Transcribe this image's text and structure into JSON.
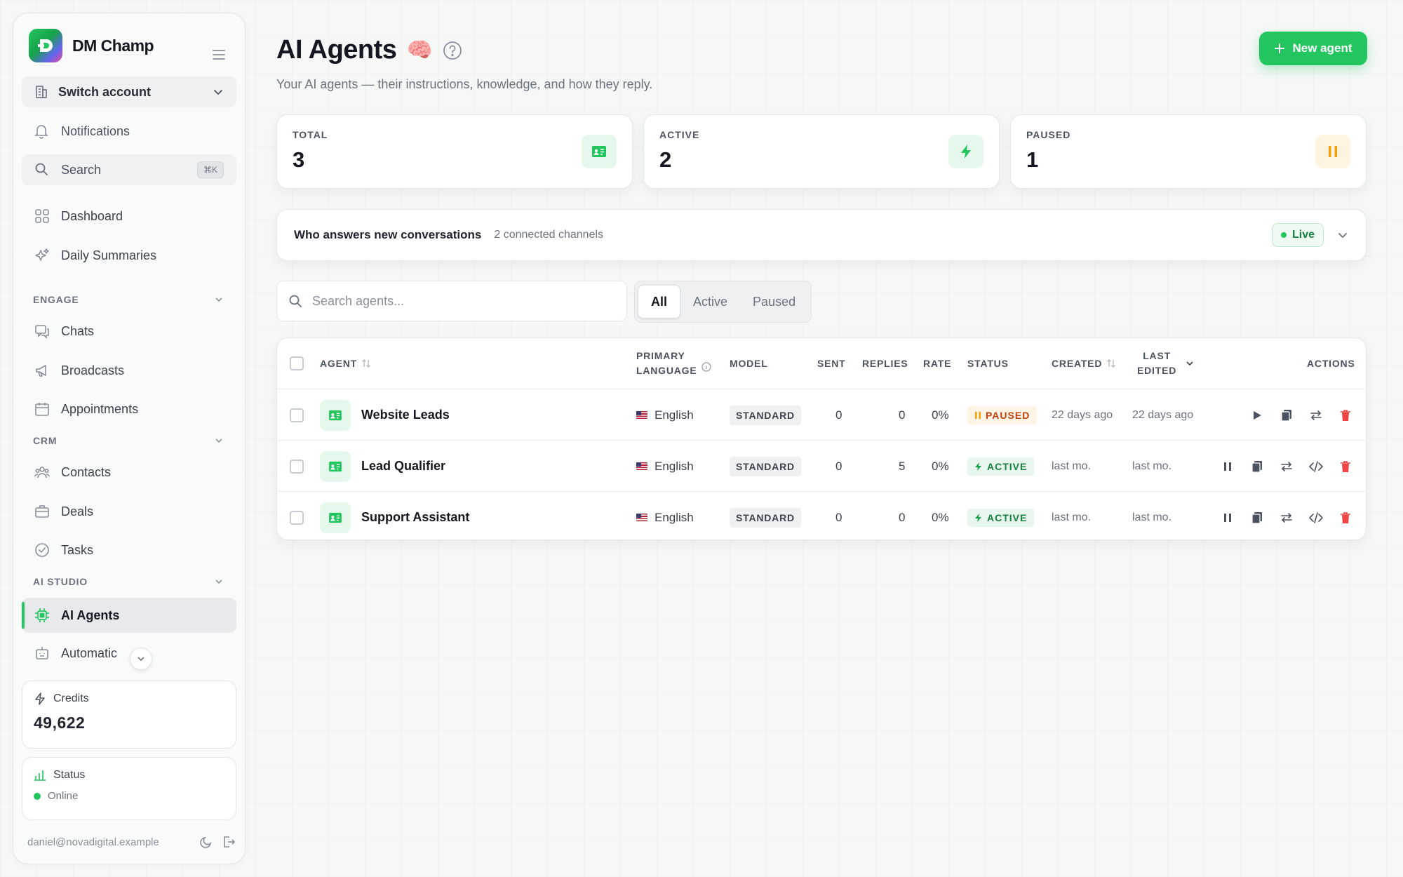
{
  "sidebar": {
    "brand": "DM Champ",
    "switch_account": "Switch account",
    "notifications": "Notifications",
    "search": "Search",
    "search_shortcut": "⌘K",
    "top_items": [
      {
        "label": "Dashboard",
        "icon": "grid-icon"
      },
      {
        "label": "Daily Summaries",
        "icon": "sparkles-icon"
      }
    ],
    "sections": [
      {
        "title": "ENGAGE",
        "items": [
          {
            "label": "Chats",
            "icon": "chat-icon"
          },
          {
            "label": "Broadcasts",
            "icon": "megaphone-icon"
          },
          {
            "label": "Appointments",
            "icon": "calendar-icon"
          }
        ]
      },
      {
        "title": "CRM",
        "items": [
          {
            "label": "Contacts",
            "icon": "users-icon"
          },
          {
            "label": "Deals",
            "icon": "briefcase-icon"
          },
          {
            "label": "Tasks",
            "icon": "check-circle-icon"
          }
        ]
      },
      {
        "title": "AI STUDIO",
        "items": [
          {
            "label": "AI Agents",
            "icon": "chip-icon",
            "active": true
          },
          {
            "label": "Automatic",
            "icon": "robot-icon"
          }
        ]
      }
    ],
    "credits": {
      "label": "Credits",
      "value": "49,622"
    },
    "status": {
      "label": "Status",
      "value": "Online"
    },
    "user_email": "daniel@novadigital.example"
  },
  "header": {
    "title": "AI Agents",
    "emoji": "🧠",
    "subtitle": "Your AI agents — their instructions, knowledge, and how they reply.",
    "new_agent": "New agent"
  },
  "stats": [
    {
      "label": "TOTAL",
      "value": "3",
      "icon": "id-card-icon"
    },
    {
      "label": "ACTIVE",
      "value": "2",
      "icon": "bolt-icon"
    },
    {
      "label": "PAUSED",
      "value": "1",
      "icon": "pause-icon"
    }
  ],
  "routing": {
    "title": "Who answers new conversations",
    "channels": "2 connected channels",
    "live": "Live"
  },
  "filters": {
    "search_placeholder": "Search agents...",
    "tabs": [
      "All",
      "Active",
      "Paused"
    ],
    "selected": "All"
  },
  "table": {
    "columns": {
      "agent": "AGENT",
      "language_1": "PRIMARY",
      "language_2": "LANGUAGE",
      "model": "MODEL",
      "sent": "SENT",
      "replies": "REPLIES",
      "rate": "RATE",
      "status": "STATUS",
      "created": "CREATED",
      "edited_1": "LAST",
      "edited_2": "EDITED",
      "actions": "ACTIONS"
    },
    "rows": [
      {
        "name": "Website Leads",
        "language": "English",
        "model": "STANDARD",
        "sent": "0",
        "replies": "0",
        "rate": "0%",
        "status": "PAUSED",
        "created": "22 days ago",
        "edited": "22 days ago"
      },
      {
        "name": "Lead Qualifier",
        "language": "English",
        "model": "STANDARD",
        "sent": "0",
        "replies": "5",
        "rate": "0%",
        "status": "ACTIVE",
        "created": "last mo.",
        "edited": "last mo."
      },
      {
        "name": "Support Assistant",
        "language": "English",
        "model": "STANDARD",
        "sent": "0",
        "replies": "0",
        "rate": "0%",
        "status": "ACTIVE",
        "created": "last mo.",
        "edited": "last mo."
      }
    ]
  },
  "colors": {
    "accent": "#22c55e",
    "paused": "#f59e0b",
    "danger": "#ef4444"
  }
}
